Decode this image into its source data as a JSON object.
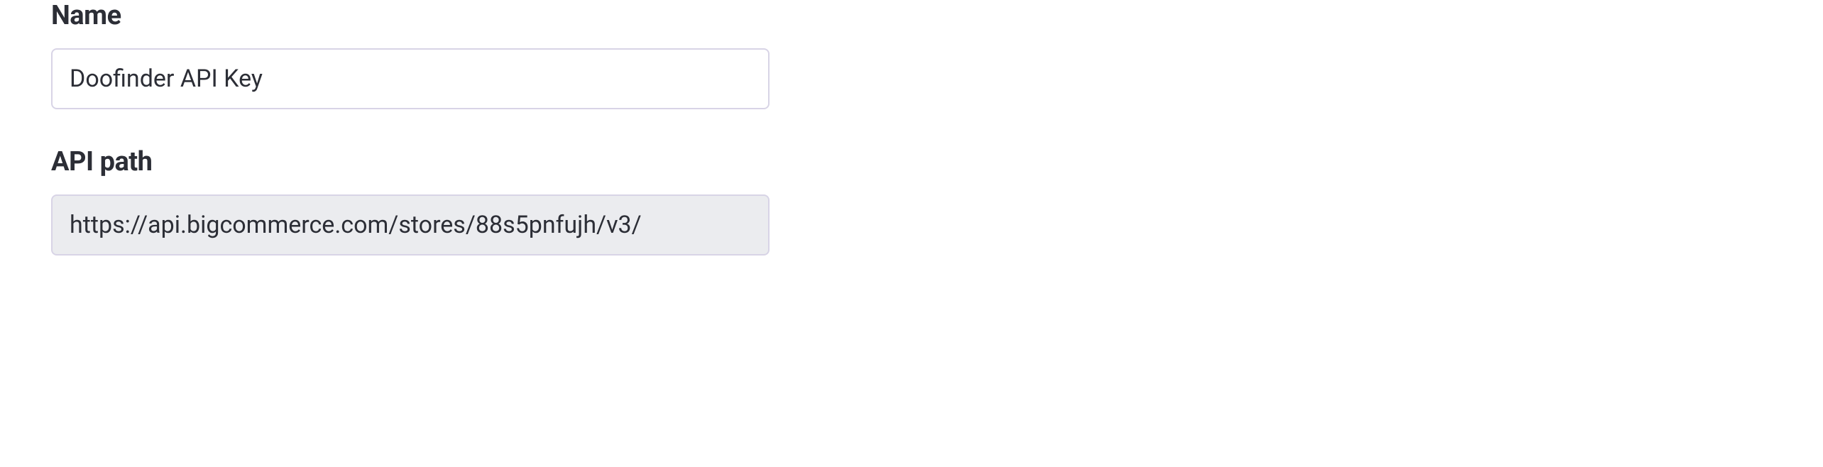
{
  "form": {
    "name": {
      "label": "Name",
      "value": "Doofinder API Key"
    },
    "apiPath": {
      "label": "API path",
      "value": "https://api.bigcommerce.com/stores/88s5pnfujh/v3/"
    }
  }
}
